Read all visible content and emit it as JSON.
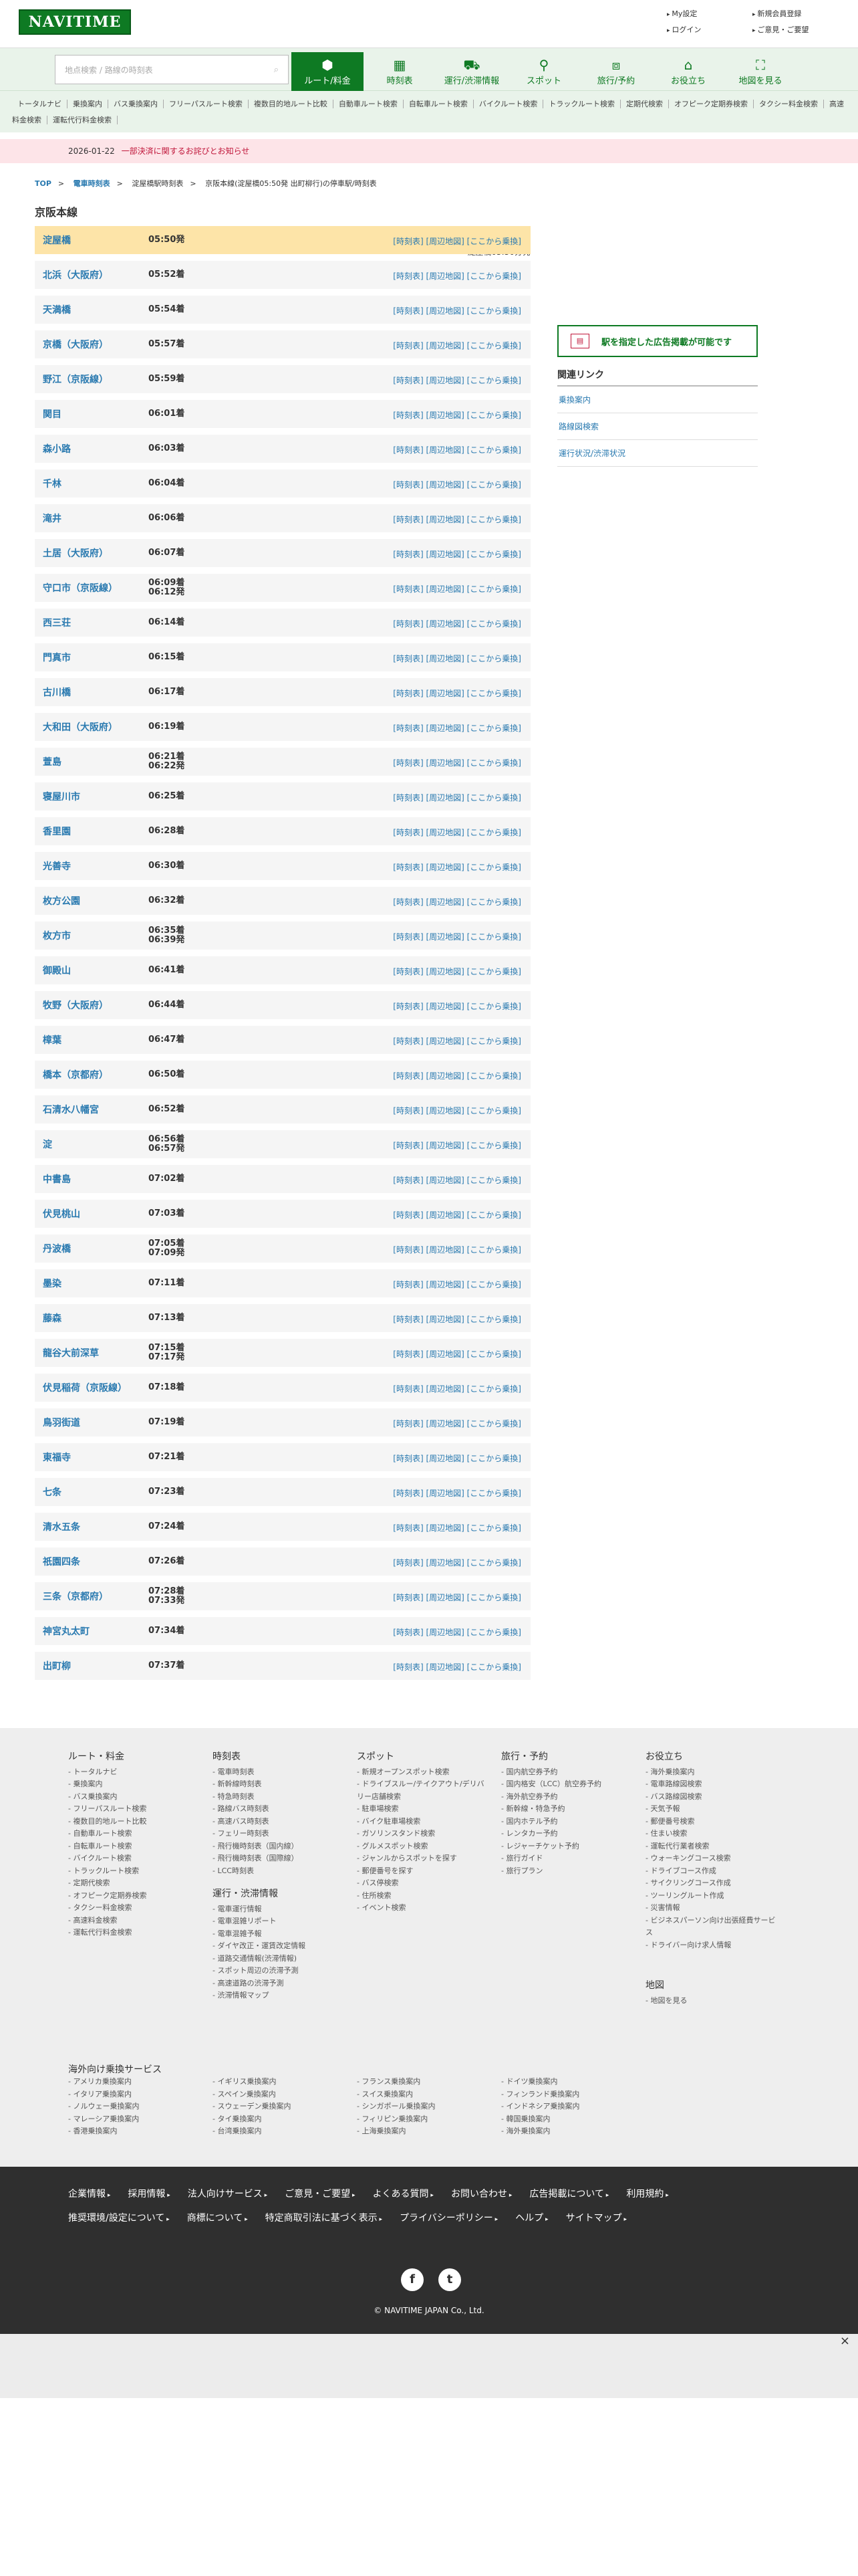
{
  "header": {
    "logo": "NAVITIME",
    "links": [
      "My設定",
      "新規会員登録",
      "ログイン",
      "ご意見・ご要望"
    ]
  },
  "search": {
    "placeholder": "地点検索 / 路線の時刻表"
  },
  "gnav": [
    {
      "label": "ルート/料金",
      "icon": "route-icon"
    },
    {
      "label": "時刻表",
      "icon": "timetable-icon"
    },
    {
      "label": "運行/渋滞情報",
      "icon": "traffic-icon"
    },
    {
      "label": "スポット",
      "icon": "spot-pin-icon"
    },
    {
      "label": "旅行/予約",
      "icon": "suitcase-icon"
    },
    {
      "label": "お役立ち",
      "icon": "house-icon"
    },
    {
      "label": "地図を見る",
      "icon": "map-icon"
    }
  ],
  "subnav": [
    "トータルナビ",
    "乗換案内",
    "バス乗換案内",
    "フリーパスルート検索",
    "複数目的地ルート比較",
    "自動車ルート検索",
    "自転車ルート検索",
    "バイクルート検索",
    "トラックルート検索",
    "定期代検索",
    "オフピーク定期券検索",
    "タクシー料金検索",
    "高速料金検索",
    "運転代行料金検索"
  ],
  "notice": {
    "date": "2026-01-22",
    "text": "一部決済に関するお詫びとお知らせ"
  },
  "breadcrumb": [
    "TOP",
    "電車時刻表",
    "淀屋橋駅時刻表",
    "京阪本線(淀屋橋05:50発 出町柳行)の停車駅/時刻表"
  ],
  "route": {
    "title": "京阪本線",
    "departure": "淀屋橋05:50分発",
    "link_text": "[時刻表] [周辺地図] [ここから乗換]"
  },
  "stations": [
    {
      "name": "淀屋橋",
      "times": [
        "05:50発"
      ]
    },
    {
      "name": "北浜（大阪府）",
      "times": [
        "05:52着"
      ]
    },
    {
      "name": "天満橋",
      "times": [
        "05:54着"
      ]
    },
    {
      "name": "京橋（大阪府）",
      "times": [
        "05:57着"
      ]
    },
    {
      "name": "野江（京阪線）",
      "times": [
        "05:59着"
      ]
    },
    {
      "name": "関目",
      "times": [
        "06:01着"
      ]
    },
    {
      "name": "森小路",
      "times": [
        "06:03着"
      ]
    },
    {
      "name": "千林",
      "times": [
        "06:04着"
      ]
    },
    {
      "name": "滝井",
      "times": [
        "06:06着"
      ]
    },
    {
      "name": "土居（大阪府）",
      "times": [
        "06:07着"
      ]
    },
    {
      "name": "守口市（京阪線）",
      "times": [
        "06:09着",
        "06:12発"
      ]
    },
    {
      "name": "西三荘",
      "times": [
        "06:14着"
      ]
    },
    {
      "name": "門真市",
      "times": [
        "06:15着"
      ]
    },
    {
      "name": "古川橋",
      "times": [
        "06:17着"
      ]
    },
    {
      "name": "大和田（大阪府）",
      "times": [
        "06:19着"
      ]
    },
    {
      "name": "萱島",
      "times": [
        "06:21着",
        "06:22発"
      ]
    },
    {
      "name": "寝屋川市",
      "times": [
        "06:25着"
      ]
    },
    {
      "name": "香里園",
      "times": [
        "06:28着"
      ]
    },
    {
      "name": "光善寺",
      "times": [
        "06:30着"
      ]
    },
    {
      "name": "枚方公園",
      "times": [
        "06:32着"
      ]
    },
    {
      "name": "枚方市",
      "times": [
        "06:35着",
        "06:39発"
      ]
    },
    {
      "name": "御殿山",
      "times": [
        "06:41着"
      ]
    },
    {
      "name": "牧野（大阪府）",
      "times": [
        "06:44着"
      ]
    },
    {
      "name": "樟葉",
      "times": [
        "06:47着"
      ]
    },
    {
      "name": "橋本（京都府）",
      "times": [
        "06:50着"
      ]
    },
    {
      "name": "石清水八幡宮",
      "times": [
        "06:52着"
      ]
    },
    {
      "name": "淀",
      "times": [
        "06:56着",
        "06:57発"
      ]
    },
    {
      "name": "中書島",
      "times": [
        "07:02着"
      ]
    },
    {
      "name": "伏見桃山",
      "times": [
        "07:03着"
      ]
    },
    {
      "name": "丹波橋",
      "times": [
        "07:05着",
        "07:09発"
      ]
    },
    {
      "name": "墨染",
      "times": [
        "07:11着"
      ]
    },
    {
      "name": "藤森",
      "times": [
        "07:13着"
      ]
    },
    {
      "name": "龍谷大前深草",
      "times": [
        "07:15着",
        "07:17発"
      ]
    },
    {
      "name": "伏見稲荷（京阪線）",
      "times": [
        "07:18着"
      ]
    },
    {
      "name": "鳥羽街道",
      "times": [
        "07:19着"
      ]
    },
    {
      "name": "東福寺",
      "times": [
        "07:21着"
      ]
    },
    {
      "name": "七条",
      "times": [
        "07:23着"
      ]
    },
    {
      "name": "清水五条",
      "times": [
        "07:24着"
      ]
    },
    {
      "name": "祇園四条",
      "times": [
        "07:26着"
      ]
    },
    {
      "name": "三条（京都府）",
      "times": [
        "07:28着",
        "07:33発"
      ]
    },
    {
      "name": "神宮丸太町",
      "times": [
        "07:34着"
      ]
    },
    {
      "name": "出町柳",
      "times": [
        "07:37着"
      ]
    }
  ],
  "sidebar": {
    "ad_button": "駅を指定した広告掲載が可能です",
    "related_title": "関連リンク",
    "related": [
      "乗換案内",
      "路線図検索",
      "運行状況/渋滞状況"
    ]
  },
  "footer": {
    "cols": [
      {
        "title": "ルート・料金",
        "items": [
          "トータルナビ",
          "乗換案内",
          "バス乗換案内",
          "フリーパスルート検索",
          "複数目的地ルート比較",
          "自動車ルート検索",
          "自転車ルート検索",
          "バイクルート検索",
          "トラックルート検索",
          "定期代検索",
          "オフピーク定期券検索",
          "タクシー料金検索",
          "高速料金検索",
          "運転代行料金検索"
        ]
      },
      {
        "title": "時刻表",
        "items": [
          "電車時刻表",
          "新幹線時刻表",
          "特急時刻表",
          "路線バス時刻表",
          "高速バス時刻表",
          "フェリー時刻表",
          "飛行機時刻表（国内線）",
          "飛行機時刻表（国際線）",
          "LCC時刻表"
        ],
        "title2": "運行・渋滞情報",
        "items2": [
          "電車運行情報",
          "電車混雑リポート",
          "電車混雑予報",
          "ダイヤ改正・運賃改定情報",
          "道路交通情報(渋滞情報)",
          "スポット周辺の渋滞予測",
          "高速道路の渋滞予測",
          "渋滞情報マップ"
        ]
      },
      {
        "title": "スポット",
        "items": [
          "新規オープンスポット検索",
          "ドライブスルー/テイクアウト/デリバリー店舗検索",
          "駐車場検索",
          "バイク駐車場検索",
          "ガソリンスタンド検索",
          "グルメスポット検索",
          "ジャンルからスポットを探す",
          "郵便番号を探す",
          "バス停検索",
          "住所検索",
          "イベント検索"
        ]
      },
      {
        "title": "旅行・予約",
        "items": [
          "国内航空券予約",
          "国内格安（LCC）航空券予約",
          "海外航空券予約",
          "新幹線・特急予約",
          "国内ホテル予約",
          "レンタカー予約",
          "レジャーチケット予約",
          "旅行ガイド",
          "旅行プラン"
        ]
      },
      {
        "title": "お役立ち",
        "items": [
          "海外乗換案内",
          "電車路線図検索",
          "バス路線図検索",
          "天気予報",
          "郵便番号検索",
          "住まい検索",
          "運転代行業者検索",
          "ウォーキングコース検索",
          "ドライブコース作成",
          "サイクリングコース作成",
          "ツーリングルート作成",
          "災害情報",
          "ビジネスパーソン向け出張経費サービス",
          "ドライバー向け求人情報"
        ],
        "title2": "地図",
        "items2": [
          "地図を見る"
        ]
      }
    ],
    "overseas_title": "海外向け乗換サービス",
    "overseas": [
      "アメリカ乗換案内",
      "イギリス乗換案内",
      "フランス乗換案内",
      "ドイツ乗換案内",
      "イタリア乗換案内",
      "スペイン乗換案内",
      "スイス乗換案内",
      "フィンランド乗換案内",
      "ノルウェー乗換案内",
      "スウェーデン乗換案内",
      "シンガポール乗換案内",
      "インドネシア乗換案内",
      "マレーシア乗換案内",
      "タイ乗換案内",
      "フィリピン乗換案内",
      "韓国乗換案内",
      "香港乗換案内",
      "台湾乗換案内",
      "上海乗換案内",
      "海外乗換案内"
    ]
  },
  "dark_footer": {
    "links": [
      "企業情報",
      "採用情報",
      "法人向けサービス",
      "ご意見・ご要望",
      "よくある質問",
      "お問い合わせ",
      "広告掲載について",
      "利用規約",
      "推奨環境/設定について",
      "商標について",
      "特定商取引法に基づく表示",
      "プライバシーポリシー",
      "ヘルプ",
      "サイトマップ"
    ],
    "social": [
      "f",
      "t"
    ],
    "copyright": "© NAVITIME JAPAN Co., Ltd."
  },
  "colors": {
    "brand": "#0e7a23",
    "link": "#2a7ab0",
    "current_row": "#fde4a8",
    "notice_bg": "#fde4e8"
  }
}
